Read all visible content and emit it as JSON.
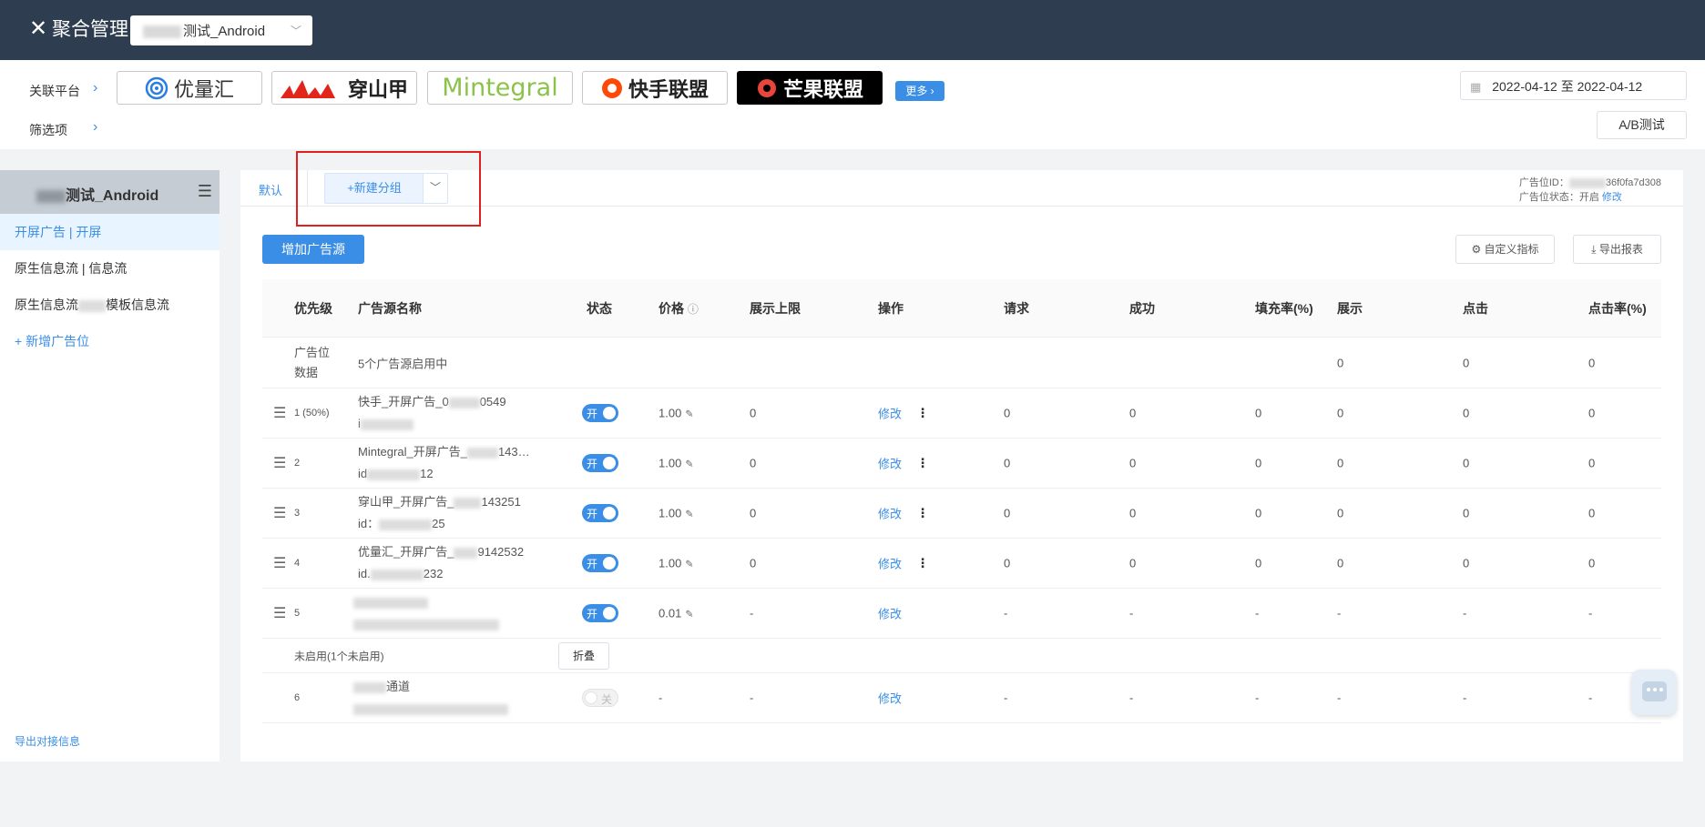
{
  "header": {
    "close_icon": "close-icon",
    "title": "聚合管理",
    "app_select_value": "测试_Android"
  },
  "filters": {
    "platform_label": "关联平台",
    "filter_label": "筛选项",
    "platforms": [
      "优量汇",
      "穿山甲",
      "Mintegral",
      "快手联盟",
      "芒果联盟"
    ],
    "more_label": "更多",
    "date_start": "2022-04-12",
    "date_sep": "至",
    "date_end": "2022-04-12",
    "ab_test_label": "A/B测试"
  },
  "sidebar": {
    "app_name": "测试_Android",
    "items": [
      "开屏广告 | 开屏",
      "原生信息流 | 信息流",
      "原生信息流",
      "模板信息流"
    ],
    "add_label": "+ 新增广告位",
    "export_label": "导出对接信息"
  },
  "main": {
    "tab_default": "默认",
    "new_group_label": "+新建分组",
    "adinfo_id_label": "广告位ID：",
    "adinfo_id_value": "36f0fa7d308",
    "adinfo_status_label": "广告位状态：",
    "adinfo_status_value": "开启",
    "adinfo_edit": "修改",
    "add_source_button": "增加广告源",
    "custom_metrics_button": "自定义指标",
    "export_report_button": "导出报表"
  },
  "table": {
    "columns": [
      "优先级",
      "广告源名称",
      "状态",
      "价格",
      "展示上限",
      "操作",
      "请求",
      "成功",
      "填充率(%)",
      "展示",
      "点击",
      "点击率(%)"
    ],
    "summary": {
      "label_line1": "广告位",
      "label_line2": "数据",
      "text": "5个广告源启用中",
      "show": "0",
      "click": "0",
      "ctr": "0"
    },
    "rows": [
      {
        "priority": "1 (50%)",
        "name": "快手_开屏广告_0",
        "name_tail": "0549",
        "id_prefix": "i",
        "id_tail": "",
        "status": "开",
        "price": "1.00",
        "limit": "0",
        "action": "修改",
        "request": "0",
        "success": "0",
        "fill": "0",
        "show": "0",
        "click": "0",
        "ctr": "0"
      },
      {
        "priority": "2",
        "name": "Mintegral_开屏广告_",
        "name_tail": "143…",
        "id_prefix": "id",
        "id_tail": "12",
        "status": "开",
        "price": "1.00",
        "limit": "0",
        "action": "修改",
        "request": "0",
        "success": "0",
        "fill": "0",
        "show": "0",
        "click": "0",
        "ctr": "0"
      },
      {
        "priority": "3",
        "name": "穿山甲_开屏广告_",
        "name_tail": "143251",
        "id_prefix": "id：",
        "id_tail": "25",
        "status": "开",
        "price": "1.00",
        "limit": "0",
        "action": "修改",
        "request": "0",
        "success": "0",
        "fill": "0",
        "show": "0",
        "click": "0",
        "ctr": "0"
      },
      {
        "priority": "4",
        "name": "优量汇_开屏广告_",
        "name_tail": "9142532",
        "id_prefix": "id.",
        "id_tail": "232",
        "status": "开",
        "price": "1.00",
        "limit": "0",
        "action": "修改",
        "request": "0",
        "success": "0",
        "fill": "0",
        "show": "0",
        "click": "0",
        "ctr": "0"
      },
      {
        "priority": "5",
        "name": "",
        "name_tail": "",
        "id_prefix": "",
        "id_tail": "",
        "status": "开",
        "price": "0.01",
        "limit": "-",
        "action": "修改",
        "request": "-",
        "success": "-",
        "fill": "-",
        "show": "-",
        "click": "-",
        "ctr": "-"
      }
    ],
    "disabled_label": "未启用(1个未启用)",
    "fold_button": "折叠",
    "disabled_row": {
      "priority": "6",
      "name_tail": "通道",
      "status": "关",
      "price": "-",
      "limit": "-",
      "action": "修改",
      "request": "-",
      "success": "-",
      "fill": "-",
      "show": "-",
      "click": "-",
      "ctr": "-"
    }
  },
  "colors": {
    "header_bg": "#2f3d50",
    "accent": "#3a8ee6",
    "highlight": "#e02020"
  }
}
